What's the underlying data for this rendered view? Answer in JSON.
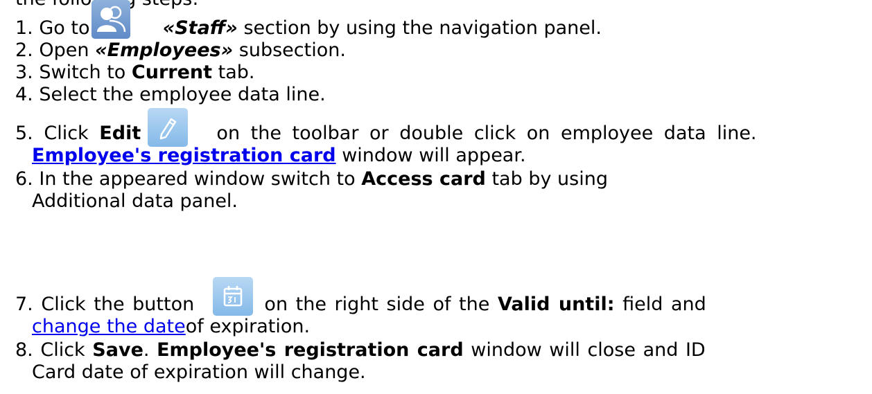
{
  "intro": "the following steps:",
  "steps": {
    "s1": {
      "num": "1.",
      "pre": "Go to",
      "name": "«Staff»",
      "post": "section by using the navigation panel."
    },
    "s2": {
      "num": "2.",
      "pre": "Open",
      "name": "«Employees»",
      "post": "subsection."
    },
    "s3": {
      "num": "3.",
      "pre": "Switch to",
      "name": "Current",
      "post": "tab."
    },
    "s4": {
      "num": "4.",
      "text": "Select the employee data line."
    },
    "s5": {
      "num": "5.",
      "pre": "Click",
      "name": "Edit",
      "post": "on the toolbar or double click on employee data line.",
      "link": "Employee's registration card",
      "post2": "window will appear."
    },
    "s6": {
      "num": "6.",
      "pre": "In the appeared window switch to",
      "name": "Access card",
      "post": "tab by using",
      "line2": "Additional data panel."
    },
    "s7": {
      "num": "7.",
      "pre": "Click the button",
      "mid": "on the right side of the",
      "name": "Valid until:",
      "post": "field and",
      "link": "change the date",
      "post2": "of expiration."
    },
    "s8": {
      "num": "8.",
      "pre": "Click",
      "name": "Save",
      "dot": ".",
      "name2": "Employee's registration card",
      "post": "window will close and ID",
      "line2": "Card date of expiration will change."
    }
  },
  "icons": {
    "staff": "staff-icon",
    "edit": "pencil-icon",
    "calendar": "calendar-icon"
  },
  "colors": {
    "link": "#0000ee",
    "icon_staff": "#6e96cc",
    "icon_button": "#9cc8ee"
  }
}
